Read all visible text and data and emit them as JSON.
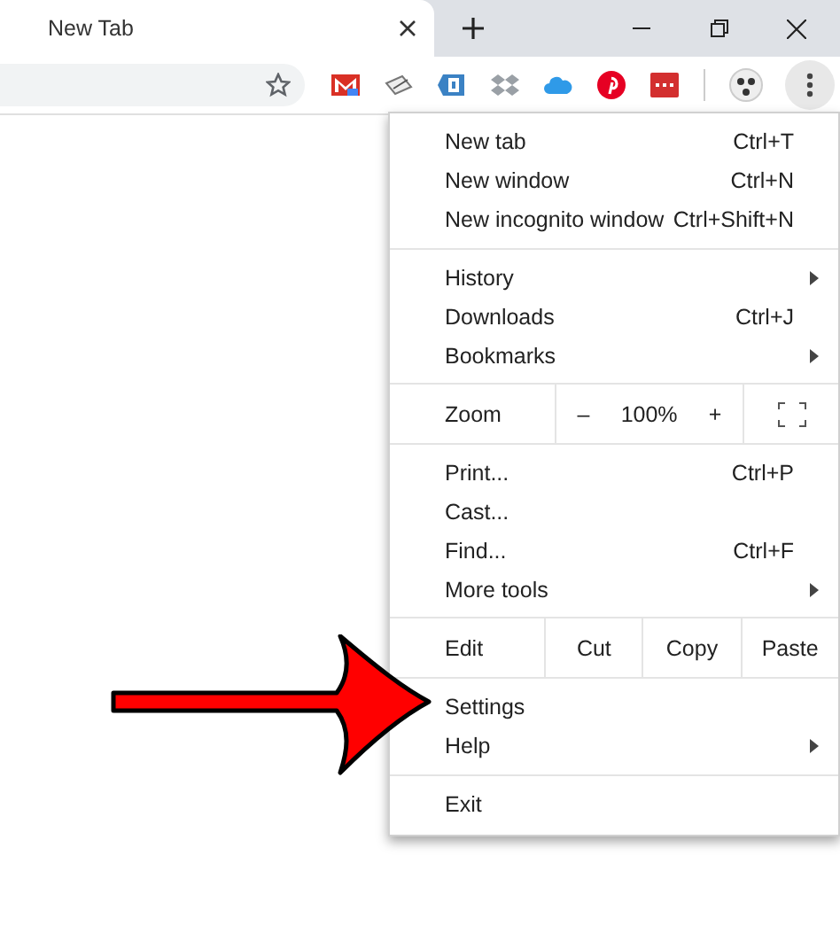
{
  "tabs": [
    {
      "label": "New Tab",
      "selected": true
    }
  ],
  "menu": {
    "sections": [
      [
        {
          "kind": "item",
          "label": "New tab",
          "shortcut": "Ctrl+T",
          "submenu": false
        },
        {
          "kind": "item",
          "label": "New window",
          "shortcut": "Ctrl+N",
          "submenu": false
        },
        {
          "kind": "item",
          "label": "New incognito window",
          "shortcut": "Ctrl+Shift+N",
          "submenu": false
        }
      ],
      [
        {
          "kind": "item",
          "label": "History",
          "submenu": true
        },
        {
          "kind": "item",
          "label": "Downloads",
          "shortcut": "Ctrl+J",
          "submenu": false
        },
        {
          "kind": "item",
          "label": "Bookmarks",
          "submenu": true
        }
      ],
      [
        {
          "kind": "zoom",
          "label": "Zoom",
          "minus": "–",
          "value": "100%",
          "plus": "+"
        }
      ],
      [
        {
          "kind": "item",
          "label": "Print...",
          "shortcut": "Ctrl+P",
          "submenu": false
        },
        {
          "kind": "item",
          "label": "Cast...",
          "submenu": false
        },
        {
          "kind": "item",
          "label": "Find...",
          "shortcut": "Ctrl+F",
          "submenu": false
        },
        {
          "kind": "item",
          "label": "More tools",
          "submenu": true
        }
      ],
      [
        {
          "kind": "edit",
          "label": "Edit",
          "buttons": [
            "Cut",
            "Copy",
            "Paste"
          ]
        }
      ],
      [
        {
          "kind": "item",
          "label": "Settings",
          "submenu": false
        },
        {
          "kind": "item",
          "label": "Help",
          "submenu": true
        }
      ],
      [
        {
          "kind": "item",
          "label": "Exit",
          "submenu": false
        }
      ]
    ]
  }
}
